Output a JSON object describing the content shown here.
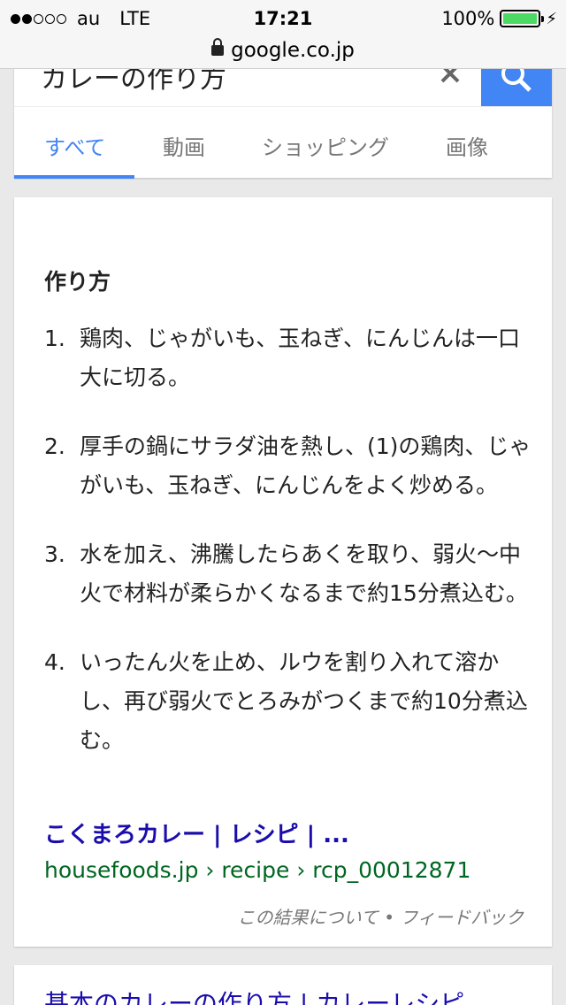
{
  "status_bar": {
    "carrier": "au",
    "network": "LTE",
    "time": "17:21",
    "battery": "100%",
    "battery_level": 1.0,
    "signal_bars_filled": 2,
    "signal_bars_total": 5
  },
  "url_bar": {
    "domain": "google.co.jp"
  },
  "search": {
    "query": "カレーの作り方",
    "tabs": [
      {
        "label": "すべて",
        "active": true
      },
      {
        "label": "動画",
        "active": false
      },
      {
        "label": "ショッピング",
        "active": false
      },
      {
        "label": "画像",
        "active": false
      }
    ]
  },
  "result": {
    "heading": "作り方",
    "steps": [
      {
        "num": "1.",
        "text": "鶏肉、じゃがいも、玉ねぎ、にんじんは一口大に切る。"
      },
      {
        "num": "2.",
        "text": "厚手の鍋にサラダ油を熱し、(1)の鶏肉、じゃがいも、玉ねぎ、にんじんをよく炒める。"
      },
      {
        "num": "3.",
        "text": "水を加え、沸騰したらあくを取り、弱火〜中火で材料が柔らかくなるまで約15分煮込む。"
      },
      {
        "num": "4.",
        "text": "いったん火を止め、ルウを割り入れて溶かし、再び弱火でとろみがつくまで約10分煮込む。"
      }
    ],
    "link_title": "こくまろカレー | レシピ | ...",
    "link_url": "housefoods.jp › recipe › rcp_00012871",
    "feedback": "この結果について • フィードバック"
  },
  "next_result": {
    "title": "基本のカレーの作り方 | カレーレシピ"
  },
  "colors": {
    "accent": "#4285f4",
    "link": "#1a0dab",
    "url": "#006621",
    "battery": "#4cd964"
  }
}
